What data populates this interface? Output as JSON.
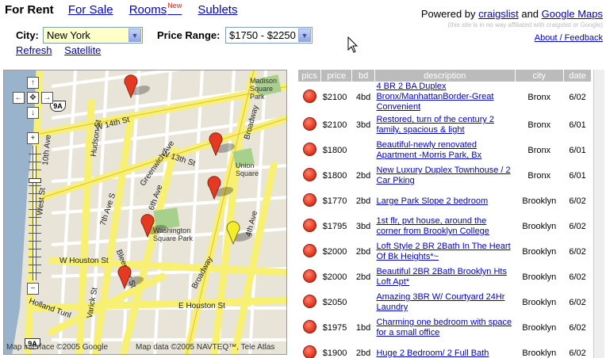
{
  "nav": {
    "active": "For Rent",
    "links": [
      "For Sale",
      "Rooms",
      "Sublets"
    ],
    "new_badge": "New"
  },
  "powered": {
    "prefix": "Powered by",
    "craigslist": "craigslist",
    "and": "and",
    "gmaps": "Google Maps"
  },
  "disclaimer": "(this site is in no way affiliated with craigslist or Google)",
  "about": "About / Feedback",
  "filters": {
    "city_label": "City:",
    "city_value": "New York",
    "price_label": "Price Range:",
    "price_value": "$1750 - $2250"
  },
  "actions": {
    "refresh": "Refresh",
    "satellite": "Satellite"
  },
  "map": {
    "streets": {
      "w14": "W 14th St",
      "w13": "W 13th St",
      "hudson": "Hudson St",
      "tenth": "10th Ave",
      "west": "West St",
      "greenwich": "Greenwich Ave",
      "seventh": "7th Ave S",
      "sixth": "6th Ave",
      "broadway": "Broadway",
      "fourth": "4th Ave",
      "bleecker": "Bleecker St",
      "varick": "Varick St",
      "whouston": "W Houston St",
      "ehouston": "E Houston St",
      "holland": "Holland Tunl",
      "wash_sq": "Washington Square Park",
      "union_sq": "Union Square",
      "madison_sq": "Madison Square Park"
    },
    "shields": [
      "9A",
      "9A"
    ],
    "copyright_left": "Map interface ©2005 Google",
    "copyright_right": "Map data ©2005 NAVTEQ™, Tele Atlas"
  },
  "listings": {
    "headers": [
      "pics",
      "price",
      "bd",
      "description",
      "city",
      "date"
    ],
    "rows": [
      {
        "price": "$2100",
        "bd": "4bd",
        "desc": "4 BR 2 BA Duplex Bronx/ManhattanBorder-Great Convenient",
        "city": "Bronx",
        "date": "6/02"
      },
      {
        "price": "$2100",
        "bd": "3bd",
        "desc": "Restored, turn of the century 2 family, spacious & light",
        "city": "Bronx",
        "date": "6/01"
      },
      {
        "price": "$1800",
        "bd": "",
        "desc": "Beautiful-newly renovated Apartment -Morris Park, Bx",
        "city": "Bronx",
        "date": "6/01"
      },
      {
        "price": "$1800",
        "bd": "2bd",
        "desc": "New Luxury Duplex Townhouse / 2 Car Pking",
        "city": "Bronx",
        "date": "6/01"
      },
      {
        "price": "$1770",
        "bd": "2bd",
        "desc": "Large Park Slope 2 bedroom",
        "city": "Brooklyn",
        "date": "6/02"
      },
      {
        "price": "$1795",
        "bd": "3bd",
        "desc": "1st flr, pvt house, around the corner from Brooklyn College",
        "city": "Brooklyn",
        "date": "6/02"
      },
      {
        "price": "$2000",
        "bd": "2bd",
        "desc": "Loft Style 2 BR 2Bath In The Heart Of Bk Heights*~",
        "city": "Brooklyn",
        "date": "6/02"
      },
      {
        "price": "$2000",
        "bd": "2bd",
        "desc": "Beautiful 2BR 2Bath Brooklyn Hts Loft Apt*",
        "city": "Brooklyn",
        "date": "6/02"
      },
      {
        "price": "$2050",
        "bd": "",
        "desc": "Amazing 3BR W/ Courtyard 24Hr Laundry",
        "city": "Brooklyn",
        "date": "6/02"
      },
      {
        "price": "$1975",
        "bd": "1bd",
        "desc": "Charming one bedroom with space for a small office",
        "city": "Brooklyn",
        "date": "6/02"
      },
      {
        "price": "$1900",
        "bd": "2bd",
        "desc": "Huge 2 Bedroom/ 2 Full Bath",
        "city": "Brooklyn",
        "date": "6/02"
      }
    ]
  },
  "colors": {
    "map_bg": "#e8e4d8",
    "road": "#f7f072",
    "water": "#99b3cc",
    "marker_red": "#e53a22",
    "marker_yellow": "#f4ee2a",
    "header_bg": "#bbbbbb",
    "link": "#0000cc"
  }
}
